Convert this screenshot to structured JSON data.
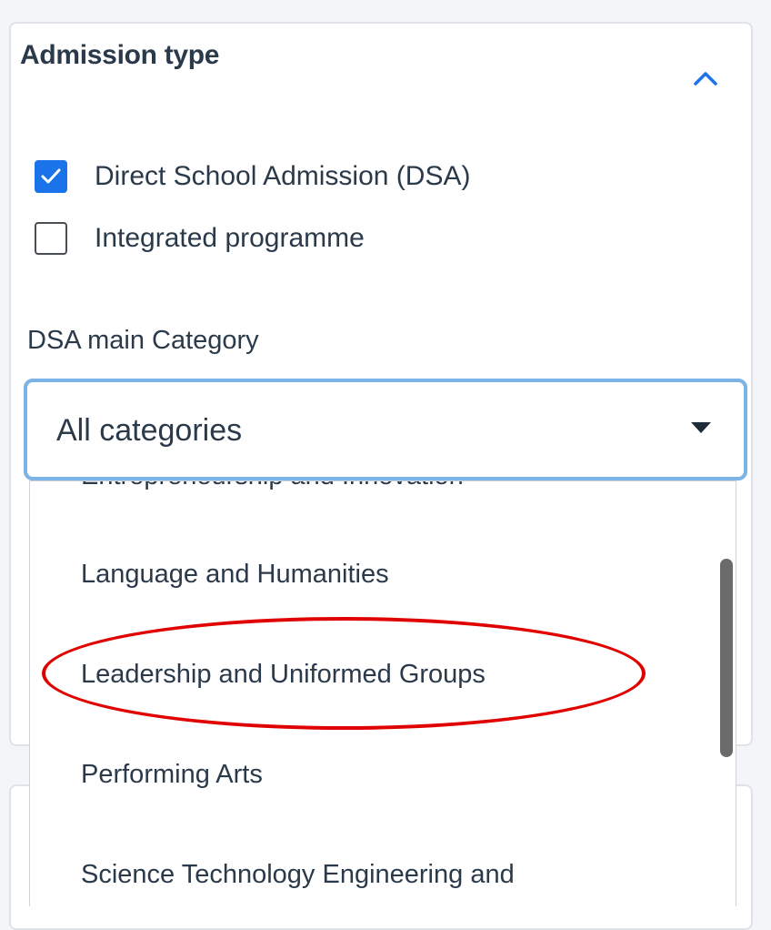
{
  "filter": {
    "section_title": "Admission type",
    "options": [
      {
        "label": "Direct School Admission (DSA)",
        "checked": true
      },
      {
        "label": "Integrated programme",
        "checked": false
      }
    ],
    "category_label": "DSA main Category",
    "category_select": {
      "value": "All categories",
      "items": [
        "Entrepreneurship and Innovation",
        "Language and Humanities",
        "Leadership and Uniformed Groups",
        "Performing Arts",
        "Science Technology Engineering and"
      ],
      "highlighted_item": "Leadership and Uniformed Groups"
    }
  },
  "colors": {
    "accent": "#1a73e8",
    "select_border": "#7bb3e6",
    "highlight": "#e00000"
  },
  "icons": {
    "collapse": "chevron-up-icon",
    "dropdown": "caret-down-icon",
    "check": "checkmark-icon"
  }
}
